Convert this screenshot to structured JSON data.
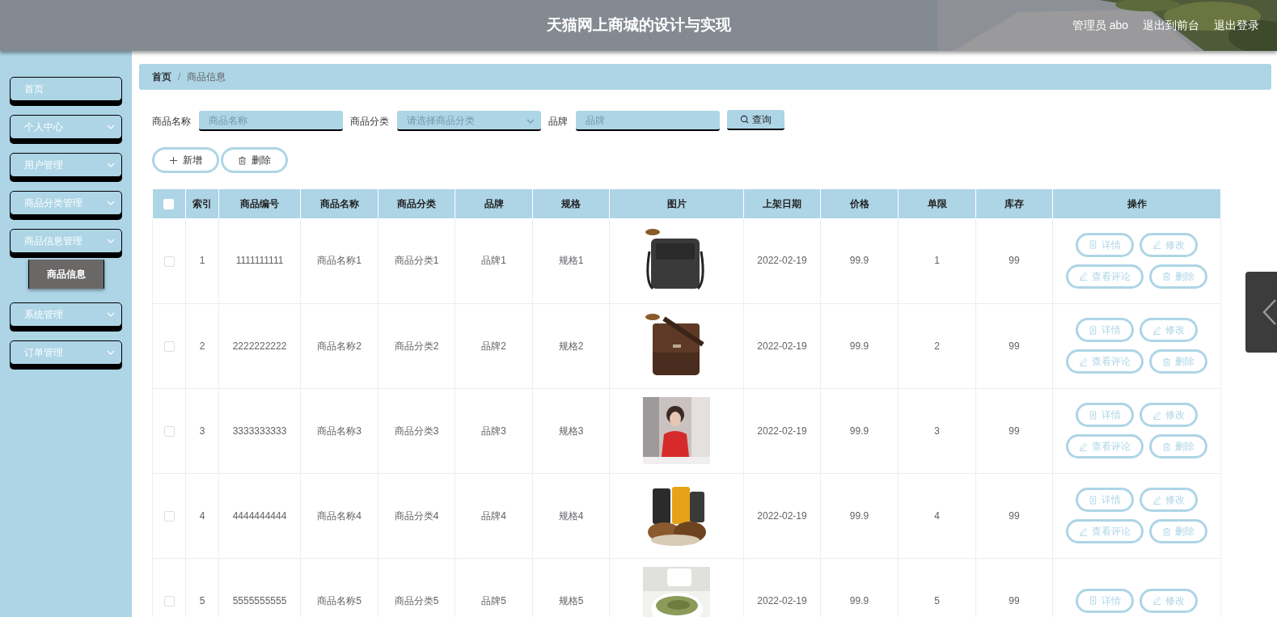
{
  "header": {
    "title": "天猫网上商城的设计与实现",
    "user": "管理员 abo",
    "links": [
      "退出到前台",
      "退出登录"
    ]
  },
  "sidebar": {
    "items": [
      {
        "label": "首页",
        "kind": "link"
      },
      {
        "label": "个人中心",
        "kind": "menu"
      },
      {
        "label": "用户管理",
        "kind": "menu"
      },
      {
        "label": "商品分类管理",
        "kind": "menu"
      },
      {
        "label": "商品信息管理",
        "kind": "menu",
        "children": [
          {
            "label": "商品信息",
            "selected": true
          }
        ]
      },
      {
        "label": "系统管理",
        "kind": "menu"
      },
      {
        "label": "订单管理",
        "kind": "menu"
      }
    ]
  },
  "breadcrumb": {
    "separator": "/",
    "items": [
      "首页",
      "商品信息"
    ]
  },
  "search": {
    "fields": [
      {
        "label": "商品名称",
        "placeholder": "商品名称",
        "kind": "text"
      },
      {
        "label": "商品分类",
        "placeholder": "请选择商品分类",
        "kind": "select"
      },
      {
        "label": "品牌",
        "placeholder": "品牌",
        "kind": "text"
      }
    ],
    "button": "查询"
  },
  "toolbar": [
    {
      "label": "新增",
      "kind": "add"
    },
    {
      "label": "删除",
      "kind": "delete"
    }
  ],
  "table": {
    "select_all_checked": false,
    "columns": [
      {
        "label": "索引",
        "kind": "text"
      },
      {
        "label": "商品编号",
        "kind": "text"
      },
      {
        "label": "商品名称",
        "kind": "text"
      },
      {
        "label": "商品分类",
        "kind": "text"
      },
      {
        "label": "品牌",
        "kind": "text"
      },
      {
        "label": "规格",
        "kind": "text"
      },
      {
        "label": "图片",
        "kind": "picture"
      },
      {
        "label": "上架日期",
        "kind": "text"
      },
      {
        "label": "价格",
        "kind": "text"
      },
      {
        "label": "单限",
        "kind": "text"
      },
      {
        "label": "库存",
        "kind": "text"
      },
      {
        "label": "操作",
        "kind": "actions"
      }
    ],
    "rows": [
      {
        "checked": false,
        "cells": [
          "1",
          "1111111111",
          "商品名称1",
          "商品分类1",
          "品牌1",
          "规格1",
          {
            "kind": "picture"
          },
          "2022-02-19",
          "99.9",
          "1",
          "99"
        ],
        "actions": [
          {
            "label": "详情",
            "kind": "detail"
          },
          {
            "label": "修改",
            "kind": "edit"
          },
          {
            "label": "查看评论",
            "kind": "edit"
          },
          {
            "label": "删除",
            "kind": "delete"
          }
        ]
      },
      {
        "checked": false,
        "cells": [
          "2",
          "2222222222",
          "商品名称2",
          "商品分类2",
          "品牌2",
          "规格2",
          {
            "kind": "picture"
          },
          "2022-02-19",
          "99.9",
          "2",
          "99"
        ],
        "actions": [
          {
            "label": "详情",
            "kind": "detail"
          },
          {
            "label": "修改",
            "kind": "edit"
          },
          {
            "label": "查看评论",
            "kind": "edit"
          },
          {
            "label": "删除",
            "kind": "delete"
          }
        ]
      },
      {
        "checked": false,
        "cells": [
          "3",
          "3333333333",
          "商品名称3",
          "商品分类3",
          "品牌3",
          "规格3",
          {
            "kind": "picture"
          },
          "2022-02-19",
          "99.9",
          "3",
          "99"
        ],
        "actions": [
          {
            "label": "详情",
            "kind": "detail"
          },
          {
            "label": "修改",
            "kind": "edit"
          },
          {
            "label": "查看评论",
            "kind": "edit"
          },
          {
            "label": "删除",
            "kind": "delete"
          }
        ]
      },
      {
        "checked": false,
        "cells": [
          "4",
          "4444444444",
          "商品名称4",
          "商品分类4",
          "品牌4",
          "规格4",
          {
            "kind": "picture"
          },
          "2022-02-19",
          "99.9",
          "4",
          "99"
        ],
        "actions": [
          {
            "label": "详情",
            "kind": "detail"
          },
          {
            "label": "修改",
            "kind": "edit"
          },
          {
            "label": "查看评论",
            "kind": "edit"
          },
          {
            "label": "删除",
            "kind": "delete"
          }
        ]
      },
      {
        "checked": false,
        "cells": [
          "5",
          "5555555555",
          "商品名称5",
          "商品分类5",
          "品牌5",
          "规格5",
          {
            "kind": "picture"
          },
          "2022-02-19",
          "99.9",
          "5",
          "99"
        ],
        "actions": [
          {
            "label": "详情",
            "kind": "detail"
          },
          {
            "label": "修改",
            "kind": "edit"
          }
        ]
      }
    ]
  }
}
